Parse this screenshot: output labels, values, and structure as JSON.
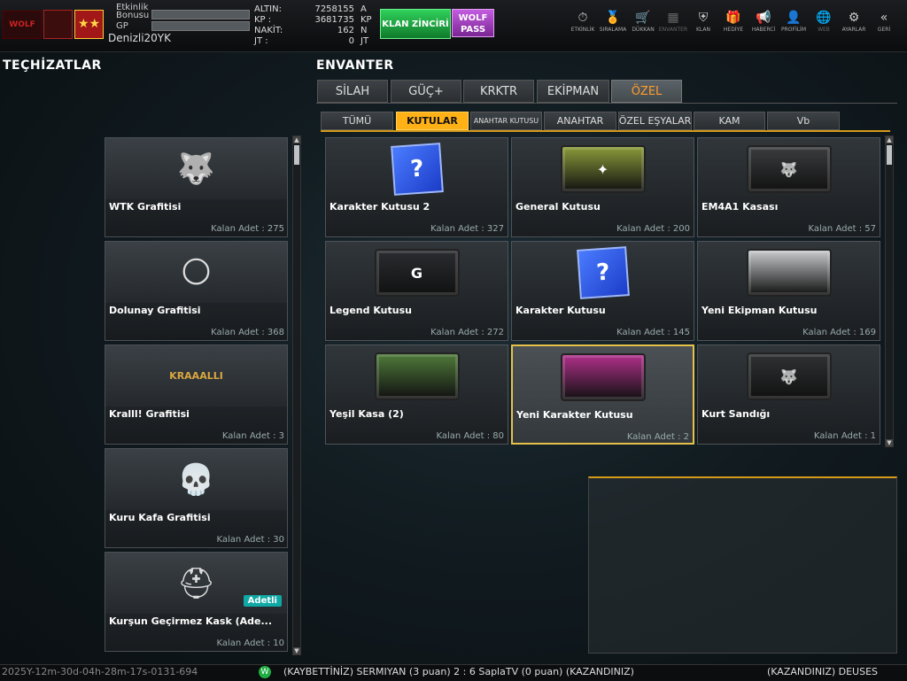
{
  "topbar": {
    "logo_text": "WOLF",
    "rank_badge": "★★",
    "bonus_label_1": "Etkinlik",
    "bonus_label_2": "Bonusu",
    "gp_label": "GP",
    "username": "Denizli20YK",
    "currencies": [
      {
        "label": "ALTIN:",
        "value": "7258155",
        "unit": "A"
      },
      {
        "label": "KP   :",
        "value": "3681735",
        "unit": "KP"
      },
      {
        "label": "NAKİT:",
        "value": "162",
        "unit": "N"
      },
      {
        "label": "JT   :",
        "value": "0",
        "unit": "JT"
      }
    ],
    "klan_button": "KLAN ZİNCİRİ",
    "wolf_pass_line1": "WOLF",
    "wolf_pass_line2": "PASS",
    "menu": [
      {
        "label": "ETKİNLİK",
        "icon": "⏱"
      },
      {
        "label": "SIRALAMA",
        "icon": "🏅"
      },
      {
        "label": "DÜKKAN",
        "icon": "🛒"
      },
      {
        "label": "ENVANTER",
        "icon": "▦"
      },
      {
        "label": "KLAN",
        "icon": "⛨"
      },
      {
        "label": "HEDİYE",
        "icon": "🎁"
      },
      {
        "label": "HABERCİ",
        "icon": "📢"
      },
      {
        "label": "PROFİLİM",
        "icon": "👤"
      },
      {
        "label": "WEB",
        "icon": "🌐"
      },
      {
        "label": "AYARLAR",
        "icon": "⚙"
      },
      {
        "label": "GERİ",
        "icon": "«"
      }
    ]
  },
  "left": {
    "title": "TEÇHİZATLAR",
    "items": [
      {
        "name": "WTK Grafitisi",
        "count": "Kalan Adet : 275",
        "icon": "🐺"
      },
      {
        "name": "Dolunay Grafitisi",
        "count": "Kalan Adet : 368",
        "icon": "🌕"
      },
      {
        "name": "Kralll! Grafitisi",
        "count": "Kalan Adet : 3",
        "icon": "KRAAALLI"
      },
      {
        "name": "Kuru Kafa Grafitisi",
        "count": "Kalan Adet : 30",
        "icon": "💀"
      },
      {
        "name": "Kurşun Geçirmez Kask (Ade...",
        "count": "Kalan Adet : 10",
        "icon": "⛑",
        "badge": "Adetli"
      }
    ]
  },
  "main": {
    "title": "ENVANTER",
    "tabs": [
      "SİLAH",
      "GÜÇ+",
      "KRKTR",
      "EKİPMAN",
      "ÖZEL"
    ],
    "subtabs": [
      "TÜMÜ",
      "KUTULAR",
      "ANAHTAR KUTUSU",
      "ANAHTAR",
      "ÖZEL EŞYALAR",
      "KAM",
      "Vb"
    ],
    "items": [
      {
        "name": "Karakter Kutusu 2",
        "count": "Kalan Adet : 327",
        "kind": "q",
        "icon": "?"
      },
      {
        "name": "General Kutusu",
        "count": "Kalan Adet : 200",
        "kind": "crate",
        "color": "#8a9a3a",
        "icon": "✦"
      },
      {
        "name": "EM4A1 Kasası",
        "count": "Kalan Adet : 57",
        "kind": "crate",
        "color": "#3a3c3e",
        "icon": "🐺"
      },
      {
        "name": "Legend Kutusu",
        "count": "Kalan Adet : 272",
        "kind": "crate",
        "color": "#2a2c30",
        "icon": "G"
      },
      {
        "name": "Karakter Kutusu",
        "count": "Kalan Adet : 145",
        "kind": "q",
        "icon": "?"
      },
      {
        "name": "Yeni Ekipman Kutusu",
        "count": "Kalan Adet : 169",
        "kind": "crate",
        "color": "#c8cacc",
        "icon": ""
      },
      {
        "name": "Yeşil Kasa (2)",
        "count": "Kalan Adet : 80",
        "kind": "crate",
        "color": "#4f7a3a",
        "icon": ""
      },
      {
        "name": "Yeni Karakter Kutusu",
        "count": "Kalan Adet : 2",
        "kind": "crate",
        "color": "#b0308a",
        "icon": "",
        "selected": true
      },
      {
        "name": "Kurt Sandığı",
        "count": "Kalan Adet : 1",
        "kind": "crate",
        "color": "#2f3133",
        "icon": "🐺"
      }
    ]
  },
  "bottom": {
    "clock": "2025Y-12m-30d-04h-28m-17s-0131-694",
    "icon": "W",
    "message": "(KAYBETTİNİZ) SERMIYAN (3 puan) 2 : 6 SaplaTV (0 puan) (KAZANDINIZ)",
    "message_right": "(KAZANDINIZ) DEUSES"
  },
  "colors": {
    "accent": "#ffb116",
    "active_tab_text": "#ff9c2a"
  }
}
